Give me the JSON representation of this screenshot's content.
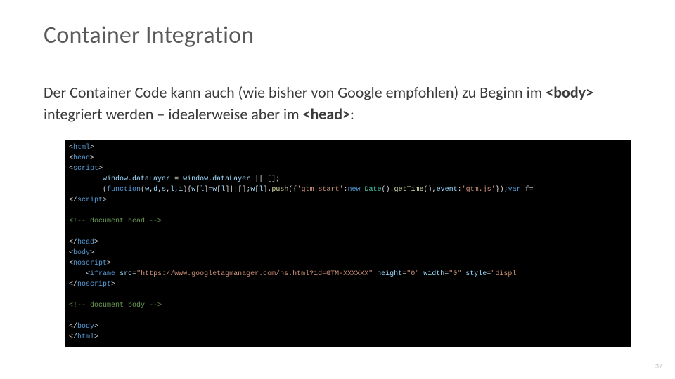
{
  "title": "Container Integration",
  "paragraph": {
    "part1": "Der Container Code kann auch (wie bisher von Google empfohlen) zu Beginn im ",
    "kw1": "<body>",
    "part2": " integriert werden – idealerweise aber im ",
    "kw2": "<head>",
    "part3": ":"
  },
  "code": {
    "l1_a": "<",
    "l1_b": "html",
    "l1_c": ">",
    "l2_a": "<",
    "l2_b": "head",
    "l2_c": ">",
    "l3_a": "<",
    "l3_b": "script",
    "l3_c": ">",
    "l4_pad": "        ",
    "l4_a": "window",
    "l4_b": ".",
    "l4_c": "dataLayer",
    "l4_d": " = ",
    "l4_e": "window",
    "l4_f": ".",
    "l4_g": "dataLayer",
    "l4_h": " || [];",
    "l5_pad": "        ",
    "l5_a": "(",
    "l5_b": "function",
    "l5_c": "(",
    "l5_d": "w",
    "l5_e": ",",
    "l5_f": "d",
    "l5_g": ",",
    "l5_h": "s",
    "l5_i": ",",
    "l5_j": "l",
    "l5_k": ",",
    "l5_l": "i",
    "l5_m": "){",
    "l5_n": "w",
    "l5_o": "[",
    "l5_p": "l",
    "l5_q": "]=",
    "l5_r": "w",
    "l5_s": "[",
    "l5_t": "l",
    "l5_u": "]||[];",
    "l5_v": "w",
    "l5_w": "[",
    "l5_x": "l",
    "l5_y": "].",
    "l5_z": "push",
    "l5_aa": "({",
    "l5_ab": "'gtm.start'",
    "l5_ac": ":",
    "l5_ad": "new",
    "l5_ae": " ",
    "l5_af": "Date",
    "l5_ag": "().",
    "l5_ah": "getTime",
    "l5_ai": "(),",
    "l5_aj": "event",
    "l5_ak": ":",
    "l5_al": "'gtm.js'",
    "l5_am": "});",
    "l5_an": "var",
    "l5_ao": " f=",
    "l6_a": "</",
    "l6_b": "script",
    "l6_c": ">",
    "l7": " ",
    "l8_a": "<!-- document head -->",
    "l9": " ",
    "l10_a": "</",
    "l10_b": "head",
    "l10_c": ">",
    "l11_a": "<",
    "l11_b": "body",
    "l11_c": ">",
    "l12_a": "<",
    "l12_b": "noscript",
    "l12_c": ">",
    "l13_pad": "    ",
    "l13_a": "<",
    "l13_b": "iframe",
    "l13_sp": " ",
    "l13_c": "src",
    "l13_d": "=",
    "l13_e": "\"https://www.googletagmanager.com/ns.html?id=GTM-XXXXXX\"",
    "l13_sp2": " ",
    "l13_f": "height",
    "l13_g": "=",
    "l13_h": "\"0\"",
    "l13_sp3": " ",
    "l13_i": "width",
    "l13_j": "=",
    "l13_k": "\"0\"",
    "l13_sp4": " ",
    "l13_l": "style",
    "l13_m": "=",
    "l13_n": "\"displ",
    "l14_a": "</",
    "l14_b": "noscript",
    "l14_c": ">",
    "l15": " ",
    "l16_a": "<!-- document body -->",
    "l17": " ",
    "l18_a": "</",
    "l18_b": "body",
    "l18_c": ">",
    "l19_a": "</",
    "l19_b": "html",
    "l19_c": ">"
  },
  "page_number": "37"
}
